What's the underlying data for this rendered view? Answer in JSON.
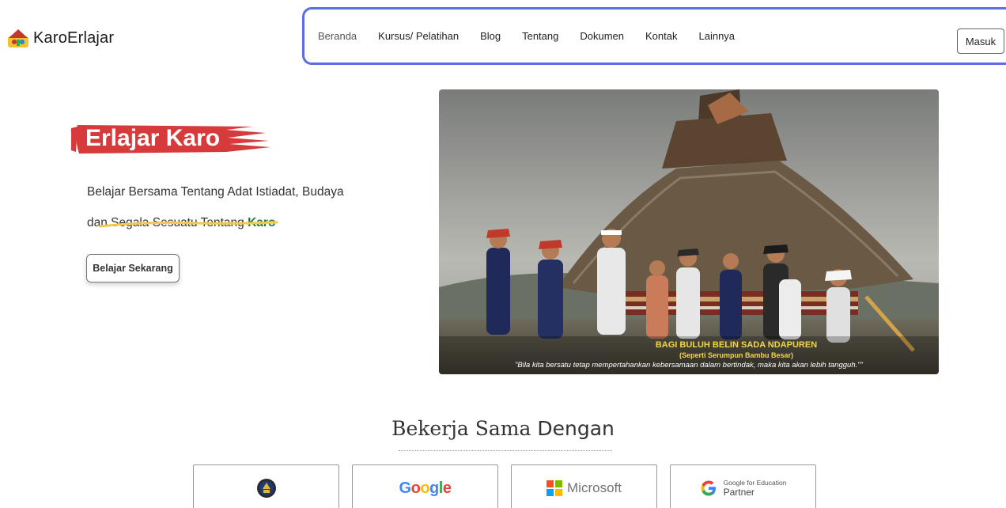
{
  "brand": {
    "name": "KaroErlajar"
  },
  "nav": {
    "items": [
      "Beranda",
      "Kursus/ Pelatihan",
      "Blog",
      "Tentang",
      "Dokumen",
      "Kontak",
      "Lainnya"
    ],
    "active": "Beranda",
    "login_label": "Masuk"
  },
  "hero": {
    "title": "Erlajar Karo",
    "desc_line1": "Belajar Bersama Tentang Adat Istiadat, Budaya",
    "desc_line2_prefix": "dan Segala Sesuatu Tentang ",
    "desc_highlight": "Karo",
    "cta_label": "Belajar Sekarang",
    "image_caption_title": "BAGI BULUH BELIN SADA NDAPUREN",
    "image_caption_sub": "(Seperti Serumpun Bambu Besar)",
    "image_caption_quote": "\"Bila kita bersatu tetap mempertahankan kebersamaan dalam bertindak, maka kita akan lebih tangguh.\"\""
  },
  "partners": {
    "title_light": "Bekerja Sama ",
    "title_bold": "Dengan",
    "logos": [
      {
        "name": "government-emblem"
      },
      {
        "name": "Google"
      },
      {
        "name": "Microsoft"
      },
      {
        "small": "Google for Education",
        "big": "Partner"
      }
    ]
  },
  "colors": {
    "accent_nav_border": "#5b6ee8",
    "brand_red": "#d63a3a",
    "highlight_green": "#1e7a3a",
    "underline_yellow": "#f2c94c"
  }
}
